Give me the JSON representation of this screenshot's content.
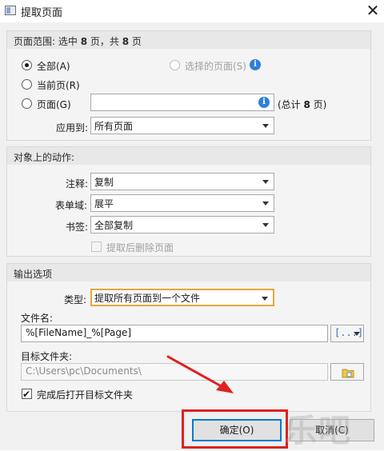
{
  "window": {
    "title": "提取页面",
    "close_glyph": "✕"
  },
  "page_range": {
    "header_prefix": "页面范围: 选中 ",
    "selected_count": "8",
    "header_middle": " 页，共 ",
    "total_count": "8",
    "header_suffix": " 页",
    "all_label": "全部(A)",
    "selected_pages_label": "选择的页面(S)",
    "current_page_label": "当前页(R)",
    "pages_label": "页面(G)",
    "pages_value": "",
    "pages_total_prefix": "(总计 ",
    "pages_total_count": "8",
    "pages_total_suffix": " 页)",
    "apply_to_label": "应用到:",
    "apply_to_value": "所有页面"
  },
  "object_actions": {
    "header": "对象上的动作:",
    "comments_label": "注释:",
    "comments_value": "复制",
    "form_fields_label": "表单域:",
    "form_fields_value": "展平",
    "bookmarks_label": "书签:",
    "bookmarks_value": "全部复制",
    "delete_after_label": "提取后删除页面"
  },
  "output": {
    "header": "输出选项",
    "type_label": "类型:",
    "type_value": "提取所有页面到一个文件",
    "filename_label": "文件名:",
    "filename_value": "%[FileName]_%[Page]",
    "macro_glyph": "[...]",
    "target_folder_label": "目标文件夹:",
    "target_folder_value": "C:\\Users\\pc\\Documents\\",
    "open_folder_label": "完成后打开目标文件夹"
  },
  "buttons": {
    "ok": "确定(O)",
    "cancel": "取消(C)"
  },
  "watermark": "乐吧",
  "colors": {
    "arrow": "#e02020",
    "highlight": "#e02020",
    "info": "#2f7fd8",
    "focus": "#e2a93b"
  },
  "icons": [
    "app-icon",
    "close-icon",
    "info-icon",
    "dropdown-caret-icon",
    "macro-icon",
    "folder-browse-icon",
    "arrow-annotation"
  ]
}
